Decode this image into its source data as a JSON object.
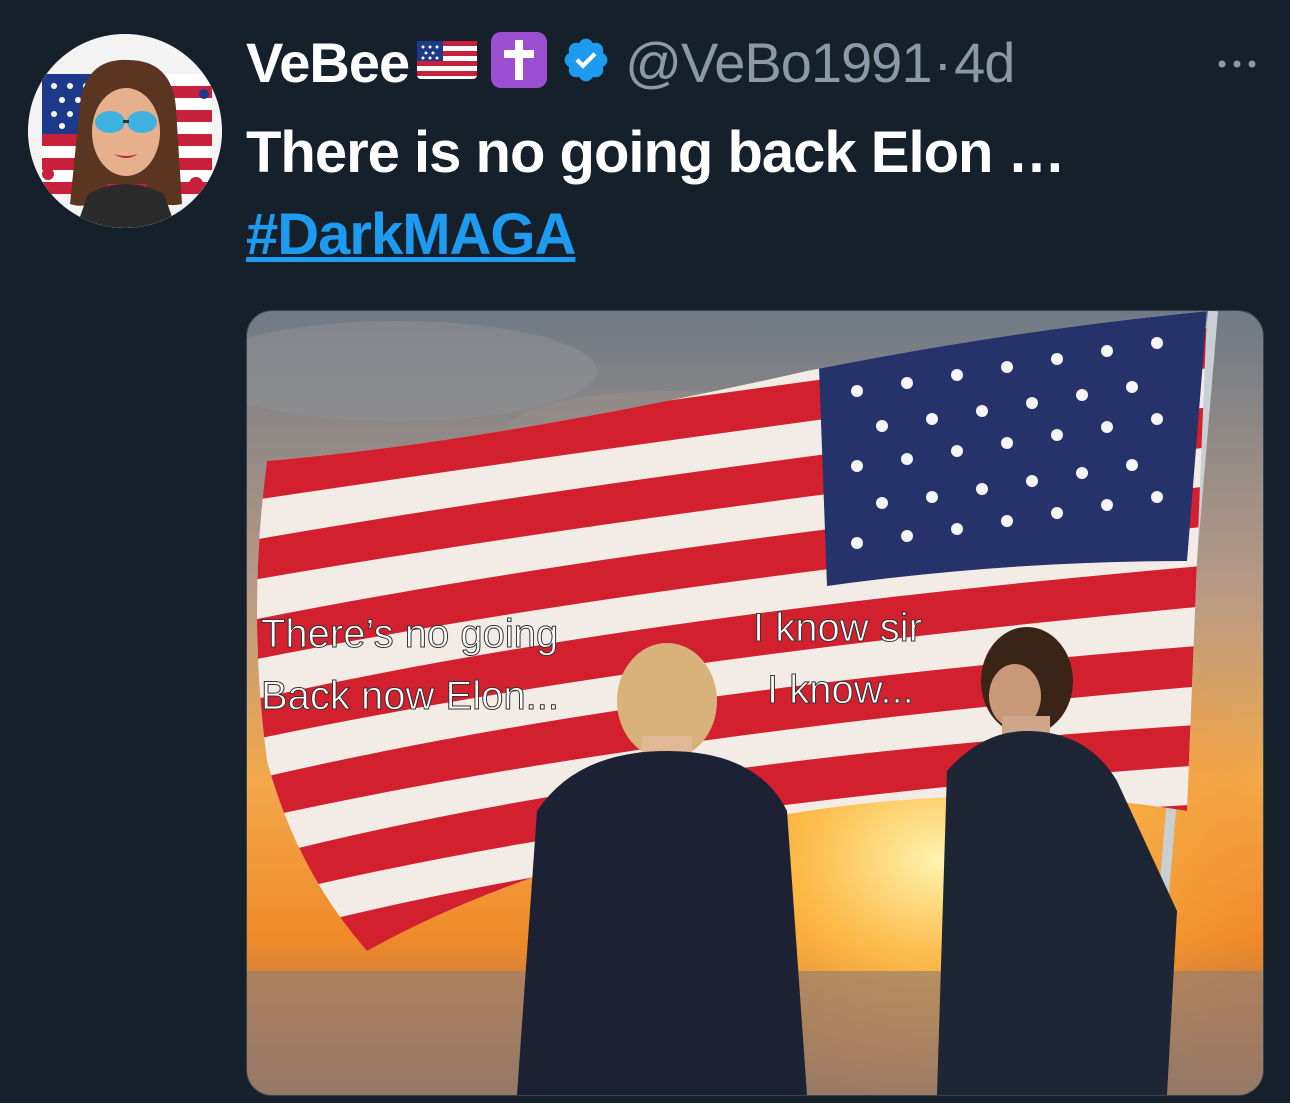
{
  "tweet": {
    "display_name": "VeBee",
    "handle": "@VeBo1991",
    "separator": "·",
    "time_ago": "4d",
    "more_label": "···",
    "text_line1": "There is no going back Elon …",
    "hashtag": "#DarkMAGA"
  },
  "icons": {
    "flag": "us-flag-emoji",
    "cross": "latin-cross-emoji",
    "verified": "verified-badge-icon",
    "more": "more-options-icon"
  },
  "colors": {
    "background": "#15202b",
    "text_primary": "#ffffff",
    "text_secondary": "#8b98a5",
    "link": "#1d9bf0",
    "verified": "#1d9bf0",
    "cross_bg": "#9b4fd0"
  },
  "media": {
    "caption_left_line1": "There’s no going",
    "caption_left_line2": "Back now Elon...",
    "caption_right_line1": "I know sir",
    "caption_right_line2": "I know..."
  }
}
